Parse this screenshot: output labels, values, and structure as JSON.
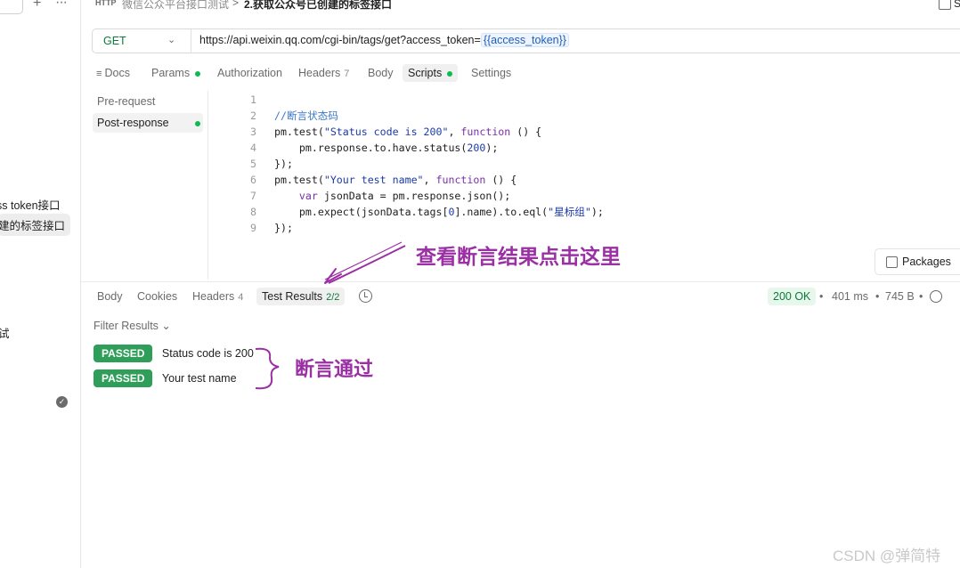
{
  "sidebar": {
    "items": [
      {
        "label": "ss token接口"
      },
      {
        "label": "建的标签接口"
      },
      {
        "label": "试"
      }
    ]
  },
  "breadcrumb": {
    "badge": "HTTP",
    "parent": "微信公众平台接口测试",
    "separator": ">",
    "current": "2.获取公众号已创建的标签接口",
    "save_label": "S"
  },
  "request": {
    "method": "GET",
    "url_prefix": "https://api.weixin.qq.com/cgi-bin/tags/get?access_token=",
    "url_variable": "{{access_token}}"
  },
  "request_tabs": {
    "docs": "Docs",
    "params": "Params",
    "authorization": "Authorization",
    "headers": "Headers",
    "headers_count": "7",
    "body": "Body",
    "scripts": "Scripts",
    "settings": "Settings"
  },
  "script_sections": {
    "pre": "Pre-request",
    "post": "Post-response"
  },
  "code": {
    "line_numbers": [
      "1",
      "2",
      "3",
      "4",
      "5",
      "6",
      "7",
      "8",
      "9"
    ],
    "l2": "//断言状态码",
    "l3a": "pm.test(",
    "l3b": "\"Status code is 200\"",
    "l3c": ", ",
    "l3d": "function",
    "l3e": " () {",
    "l4a": "    pm.response.to.have.status(",
    "l4b": "200",
    "l4c": ");",
    "l5": "});",
    "l6a": "pm.test(",
    "l6b": "\"Your test name\"",
    "l6c": ", ",
    "l6d": "function",
    "l6e": " () {",
    "l7a": "    ",
    "l7b": "var",
    "l7c": " jsonData = pm.response.json();",
    "l8a": "    pm.expect(jsonData.tags[",
    "l8b": "0",
    "l8c": "].name).to.eql(",
    "l8d": "\"星标组\"",
    "l8e": ");",
    "l9": "});"
  },
  "packages_label": "Packages",
  "response_tabs": {
    "body": "Body",
    "cookies": "Cookies",
    "headers": "Headers",
    "headers_count": "4",
    "test_results": "Test Results",
    "test_results_count": "2/2"
  },
  "response_meta": {
    "status": "200 OK",
    "time": "401 ms",
    "size": "745 B",
    "bullet": "•"
  },
  "filter_label": "Filter Results ⌄",
  "results": [
    {
      "badge": "PASSED",
      "name": "Status code is 200"
    },
    {
      "badge": "PASSED",
      "name": "Your test name"
    }
  ],
  "annotations": {
    "arrow_note": "查看断言结果点击这里",
    "brace_note": "断言通过",
    "color": "#9b30a5"
  },
  "watermark": "CSDN @弹简特"
}
